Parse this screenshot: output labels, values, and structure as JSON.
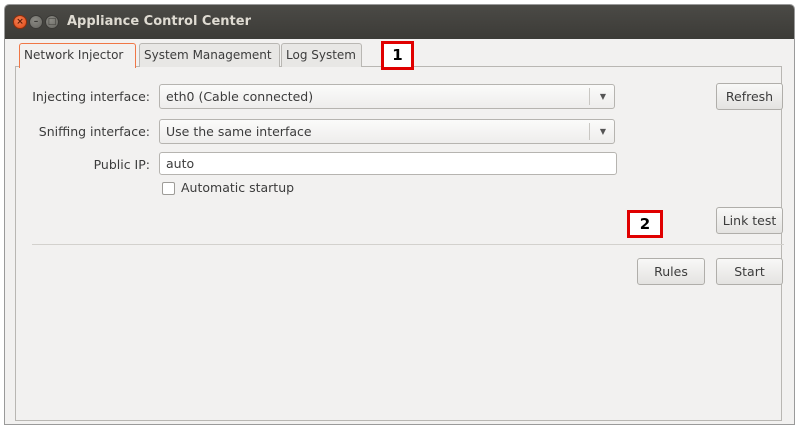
{
  "window": {
    "title": "Appliance Control Center",
    "buttons": {
      "close": "×",
      "minimize": "–",
      "maximize": "□"
    }
  },
  "tabs": [
    {
      "label": "Network Injector",
      "active": true
    },
    {
      "label": "System Management",
      "active": false
    },
    {
      "label": "Log System",
      "active": false
    }
  ],
  "markers": {
    "one": "1",
    "two": "2"
  },
  "form": {
    "injecting": {
      "label": "Injecting interface:",
      "value": "eth0 (Cable connected)"
    },
    "sniffing": {
      "label": "Sniffing interface:",
      "value": "Use the same interface"
    },
    "public_ip": {
      "label": "Public IP:",
      "value": "auto"
    },
    "startup": {
      "label": "Automatic startup",
      "checked": false
    }
  },
  "buttons": {
    "refresh": "Refresh",
    "link_test": "Link test",
    "rules": "Rules",
    "start": "Start"
  },
  "icons": {
    "dropdown": "chevron-down-icon"
  },
  "colors": {
    "titlebar": "#3c3b37",
    "active_tab_border": "#f07746",
    "marker": "#e00000",
    "close_button": "#df4a16"
  }
}
